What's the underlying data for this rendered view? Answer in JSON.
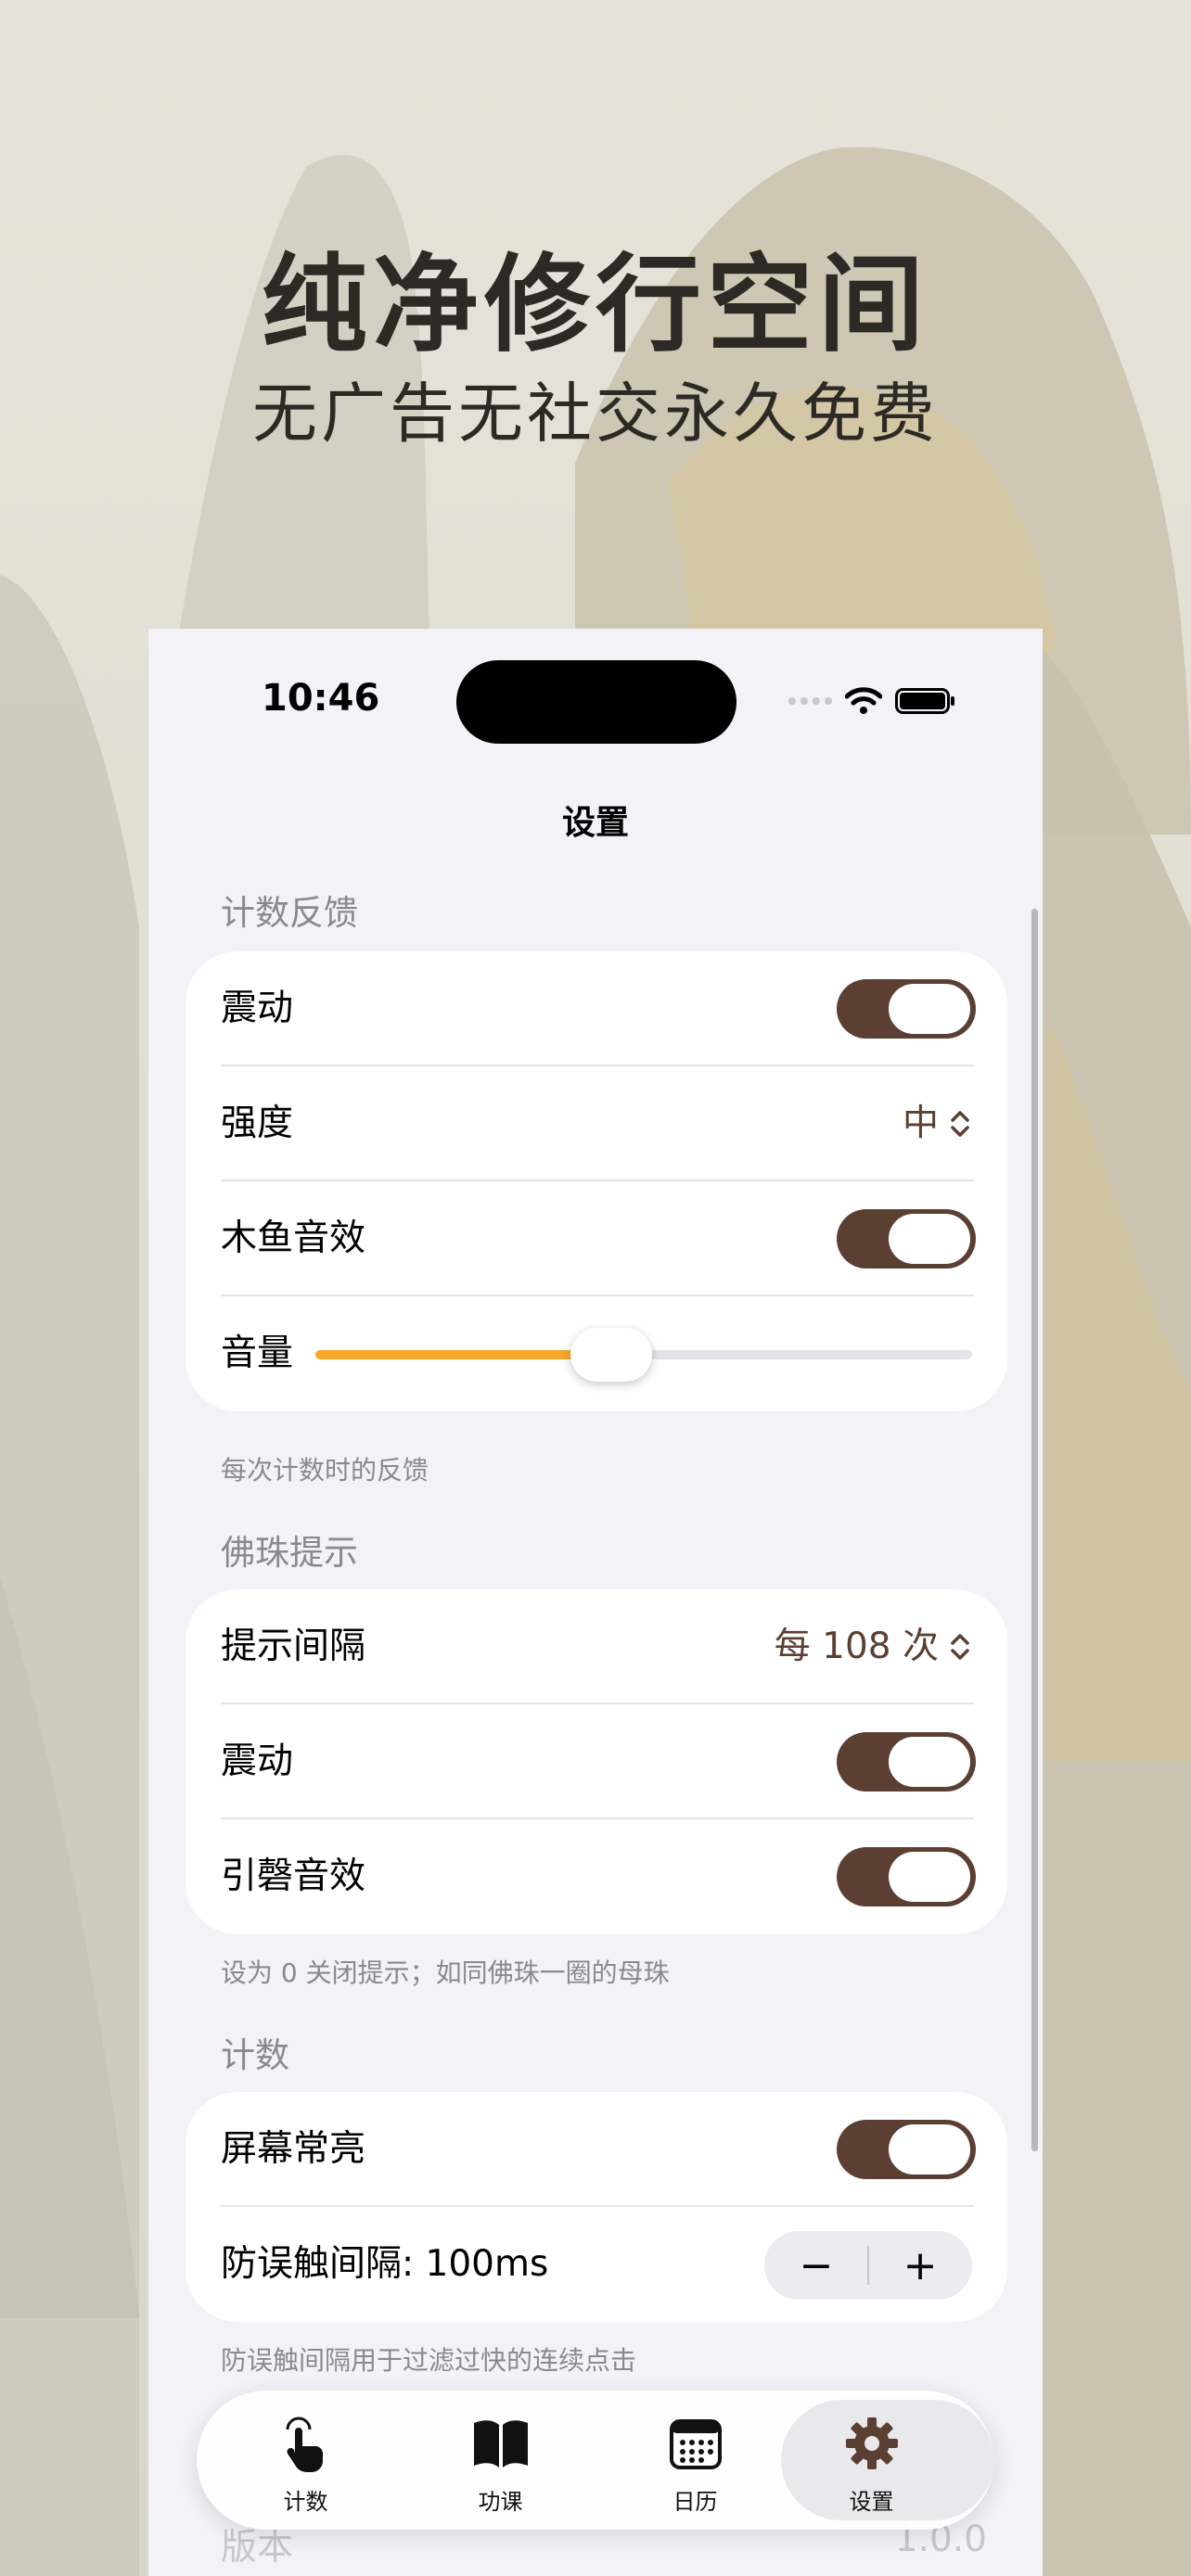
{
  "promo": {
    "headline": "纯净修行空间",
    "subline": "无广告无社交永久免费"
  },
  "status_bar": {
    "time": "10:46",
    "icons": [
      "signal-icon",
      "wifi-icon",
      "battery-icon"
    ]
  },
  "nav": {
    "title": "设置"
  },
  "sections": {
    "feedback": {
      "header": "计数反馈",
      "vibration_label": "震动",
      "vibration_on": true,
      "intensity_label": "强度",
      "intensity_value": "中",
      "muyu_label": "木鱼音效",
      "muyu_on": true,
      "volume_label": "音量",
      "volume_level": 0.45,
      "footnote": "每次计数时的反馈"
    },
    "beads": {
      "header": "佛珠提示",
      "interval_label": "提示间隔",
      "interval_value": "每 108 次",
      "vibration_label": "震动",
      "vibration_on": true,
      "bell_label": "引磬音效",
      "bell_on": true,
      "footnote": "设为 0 关闭提示；如同佛珠一圈的母珠"
    },
    "count": {
      "header": "计数",
      "screen_on_label": "屏幕常亮",
      "screen_on": true,
      "debounce_label": "防误触间隔: 100ms",
      "minus_label": "−",
      "plus_label": "+",
      "footnote": "防误触间隔用于过滤过快的连续点击"
    },
    "about": {
      "version_label": "版本",
      "version_value": "1.0.0"
    }
  },
  "tabbar": {
    "tabs": [
      {
        "label": "计数",
        "icon": "tap-hand-icon",
        "active": false
      },
      {
        "label": "功课",
        "icon": "book-icon",
        "active": false
      },
      {
        "label": "日历",
        "icon": "calendar-icon",
        "active": false
      },
      {
        "label": "设置",
        "icon": "gear-icon",
        "active": true
      }
    ]
  },
  "colors": {
    "accent": "#5b3f33",
    "slider": "#f7a72a",
    "background": "#f2f2f7",
    "poster_bg": "#e3e0d5"
  }
}
